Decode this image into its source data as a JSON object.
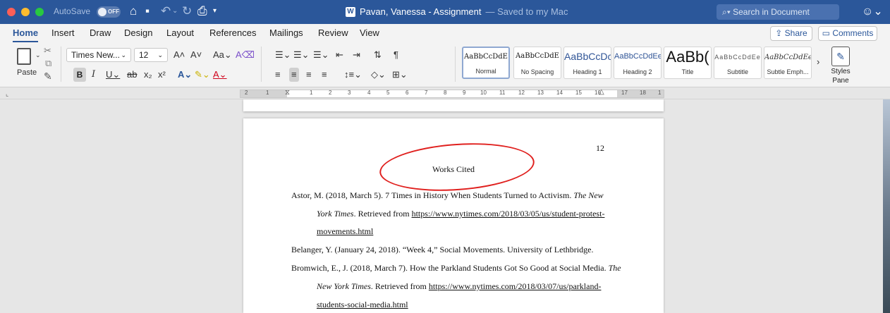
{
  "titlebar": {
    "autosave_label": "AutoSave",
    "autosave_state": "OFF",
    "doc_name": "Pavan, Vanessa - Assignment",
    "doc_status": "— Saved to my Mac",
    "search_placeholder": "Search in Document"
  },
  "tabs": [
    "Home",
    "Insert",
    "Draw",
    "Design",
    "Layout",
    "References",
    "Mailings",
    "Review",
    "View"
  ],
  "active_tab": "Home",
  "share_label": "Share",
  "comments_label": "Comments",
  "ribbon": {
    "paste_label": "Paste",
    "font_name": "Times New...",
    "font_size": "12",
    "styles_pane_label_1": "Styles",
    "styles_pane_label_2": "Pane"
  },
  "styles": [
    {
      "sample": "AaBbCcDdE",
      "name": "Normal"
    },
    {
      "sample": "AaBbCcDdE",
      "name": "No Spacing"
    },
    {
      "sample": "AaBbCcDc",
      "name": "Heading 1"
    },
    {
      "sample": "AaBbCcDdEe",
      "name": "Heading 2"
    },
    {
      "sample": "AaBb(",
      "name": "Title"
    },
    {
      "sample": "AaBbCcDdEe",
      "name": "Subtitle"
    },
    {
      "sample": "AaBbCcDdEe",
      "name": "Subtle Emph..."
    }
  ],
  "ruler_numbers": [
    "2",
    "1",
    "1",
    "2",
    "3",
    "4",
    "5",
    "6",
    "7",
    "8",
    "9",
    "10",
    "11",
    "12",
    "13",
    "14",
    "15",
    "16",
    "17",
    "18",
    "1"
  ],
  "document": {
    "page_number": "12",
    "heading": "Works Cited",
    "citations": [
      {
        "line1_pre": "Astor, M. (2018, March 5). 7 Times in History When Students Turned to Activism. ",
        "line1_italic": "The New",
        "line2_italic": "York Times",
        "line2_mid": ". Retrieved from ",
        "line2_link": "https://www.nytimes.com/2018/03/05/us/student-protest-",
        "line3_link": "movements.html"
      },
      {
        "line1_pre": "Belanger, Y. (January 24, 2018). “Week 4,” Social Movements. University of Lethbridge."
      },
      {
        "line1_pre": "Bromwich, E., J. (2018, March 7). How the Parkland Students Got So Good at Social Media. ",
        "line1_italic": "The",
        "line2_italic": "New York Times",
        "line2_mid": ". Retrieved from ",
        "line2_link": "https://www.nytimes.com/2018/03/07/us/parkland-",
        "line3_link": "students-social-media.html"
      }
    ]
  }
}
